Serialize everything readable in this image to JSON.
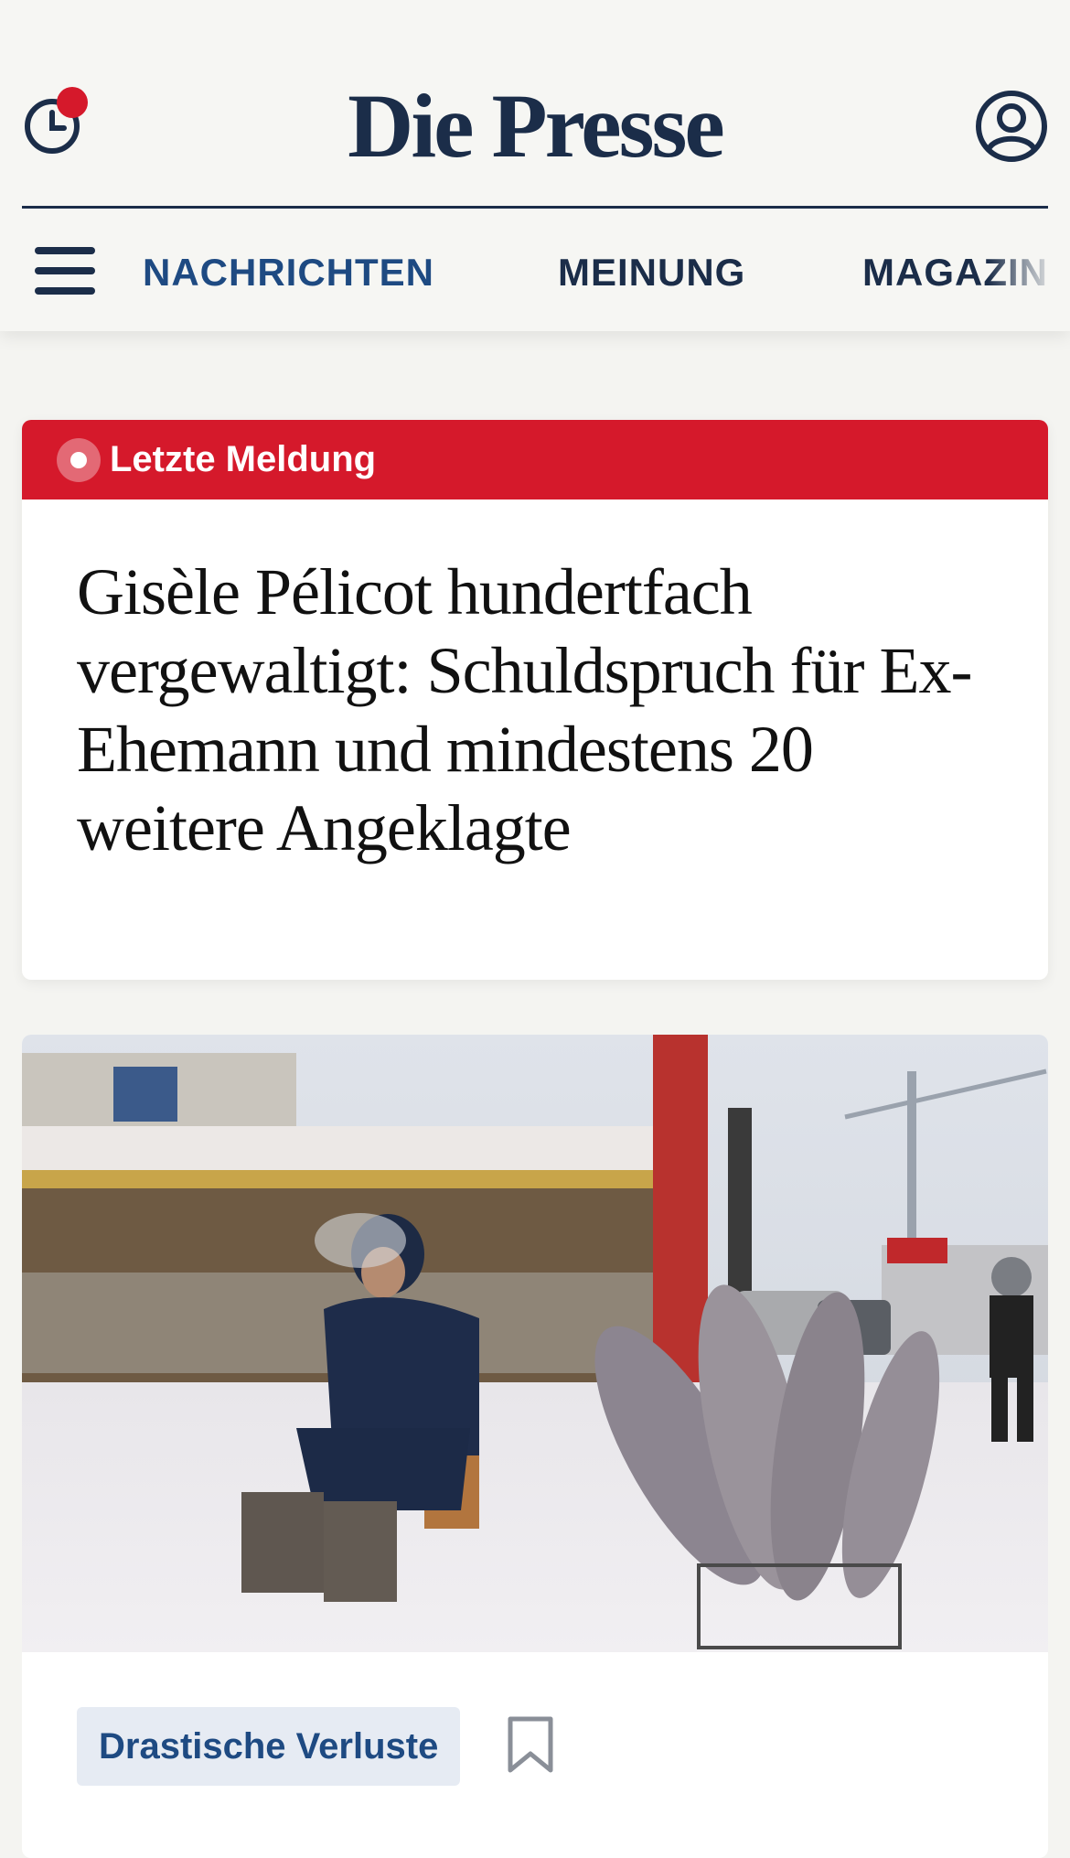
{
  "header": {
    "logo": "Die Presse",
    "history_icon": "clock-history-icon",
    "account_icon": "user-account-icon",
    "menu_icon": "hamburger-menu-icon"
  },
  "nav": {
    "items": [
      {
        "label": "NACHRICHTEN",
        "color": "#1e4a82"
      },
      {
        "label": "MEINUNG",
        "color": "#1b2d49"
      },
      {
        "label": "MAGAZIN",
        "color": "#1b2d49"
      }
    ]
  },
  "breaking": {
    "label": "Letzte Meldung",
    "headline": "Gisèle Pélicot hundertfach vergewaltigt: Schuldspruch für Ex-Ehemann und mindestens 20 weitere Angeklagte"
  },
  "story": {
    "tag": "Drastische Verluste",
    "bookmark_icon": "bookmark-icon"
  },
  "colors": {
    "brand_navy": "#1b2d49",
    "accent_red": "#d5192b",
    "link_blue": "#1e4a82",
    "page_bg": "#f4f4f1"
  }
}
